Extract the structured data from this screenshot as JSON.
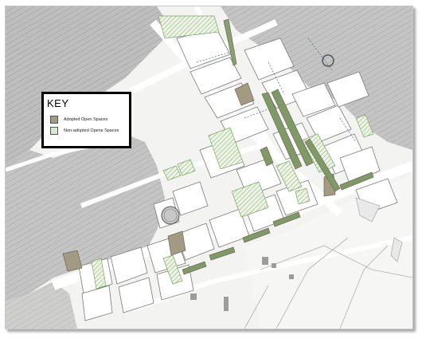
{
  "map": {
    "background": "#f3f3f1",
    "building_color": "#9c9c9c",
    "road_color": "#ffffff",
    "block_outline": "#7a7a7a"
  },
  "key": {
    "title": "KEY",
    "items": [
      {
        "label": "Adopted Open Spaces",
        "color": "#a39a82"
      },
      {
        "label": "Non-adopted Opens Spaces",
        "color": "#dbe8d0"
      }
    ]
  }
}
